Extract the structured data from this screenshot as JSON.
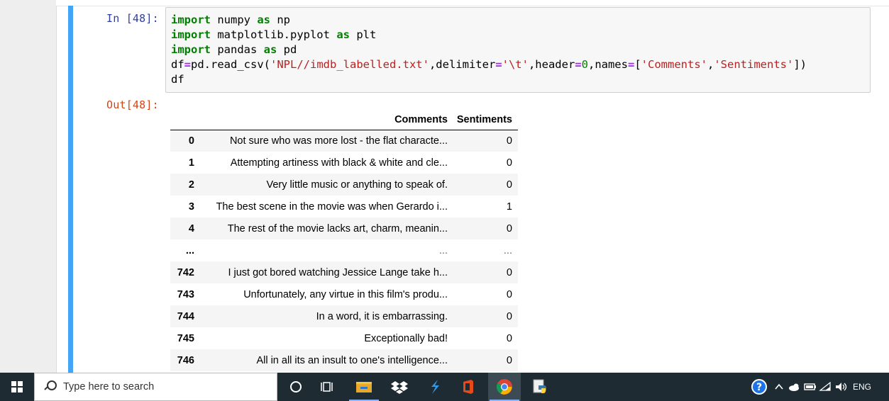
{
  "notebook": {
    "in_prompt": "In [48]:",
    "out_prompt": "Out[48]:",
    "code": [
      [
        {
          "t": "import",
          "c": "kw"
        },
        {
          "t": " numpy ",
          "c": ""
        },
        {
          "t": "as",
          "c": "kw"
        },
        {
          "t": " np",
          "c": ""
        }
      ],
      [
        {
          "t": "import",
          "c": "kw"
        },
        {
          "t": " matplotlib.pyplot ",
          "c": ""
        },
        {
          "t": "as",
          "c": "kw"
        },
        {
          "t": " plt",
          "c": ""
        }
      ],
      [
        {
          "t": "import",
          "c": "kw"
        },
        {
          "t": " pandas ",
          "c": ""
        },
        {
          "t": "as",
          "c": "kw"
        },
        {
          "t": " pd",
          "c": ""
        }
      ],
      [
        {
          "t": "df",
          "c": ""
        },
        {
          "t": "=",
          "c": "op"
        },
        {
          "t": "pd.read_csv(",
          "c": ""
        },
        {
          "t": "'NPL//imdb_labelled.txt'",
          "c": "str"
        },
        {
          "t": ",delimiter",
          "c": ""
        },
        {
          "t": "=",
          "c": "op"
        },
        {
          "t": "'\\t'",
          "c": "str"
        },
        {
          "t": ",header",
          "c": ""
        },
        {
          "t": "=",
          "c": "op"
        },
        {
          "t": "0",
          "c": "num"
        },
        {
          "t": ",names",
          "c": ""
        },
        {
          "t": "=",
          "c": "op"
        },
        {
          "t": "[",
          "c": ""
        },
        {
          "t": "'Comments'",
          "c": "str"
        },
        {
          "t": ",",
          "c": ""
        },
        {
          "t": "'Sentiments'",
          "c": "str"
        },
        {
          "t": "])",
          "c": ""
        }
      ],
      [
        {
          "t": "df",
          "c": ""
        }
      ]
    ]
  },
  "dataframe": {
    "columns": [
      "",
      "Comments",
      "Sentiments"
    ],
    "rows": [
      [
        "0",
        "Not sure who was more lost - the flat characte...",
        "0"
      ],
      [
        "1",
        "Attempting artiness with black & white and cle...",
        "0"
      ],
      [
        "2",
        "Very little music or anything to speak of.",
        "0"
      ],
      [
        "3",
        "The best scene in the movie was when Gerardo i...",
        "1"
      ],
      [
        "4",
        "The rest of the movie lacks art, charm, meanin...",
        "0"
      ],
      [
        "...",
        "...",
        "..."
      ],
      [
        "742",
        "I just got bored watching Jessice Lange take h...",
        "0"
      ],
      [
        "743",
        "Unfortunately, any virtue in this film's produ...",
        "0"
      ],
      [
        "744",
        "In a word, it is embarrassing.",
        "0"
      ],
      [
        "745",
        "Exceptionally bad!",
        "0"
      ],
      [
        "746",
        "All in all its an insult to one's intelligence...",
        "0"
      ]
    ]
  },
  "taskbar": {
    "search_placeholder": "Type here to search",
    "language": "ENG",
    "icons": [
      "windows-start-icon",
      "search-icon",
      "cortana-icon",
      "task-view-icon",
      "file-explorer-icon",
      "dropbox-icon",
      "vscode-icon",
      "office-icon",
      "chrome-icon",
      "python-idle-icon"
    ]
  },
  "colors": {
    "cell_bar": "#42a5f5",
    "taskbar_bg": "#1e2b33",
    "in_prompt": "#303f9f",
    "out_prompt": "#d84315"
  }
}
